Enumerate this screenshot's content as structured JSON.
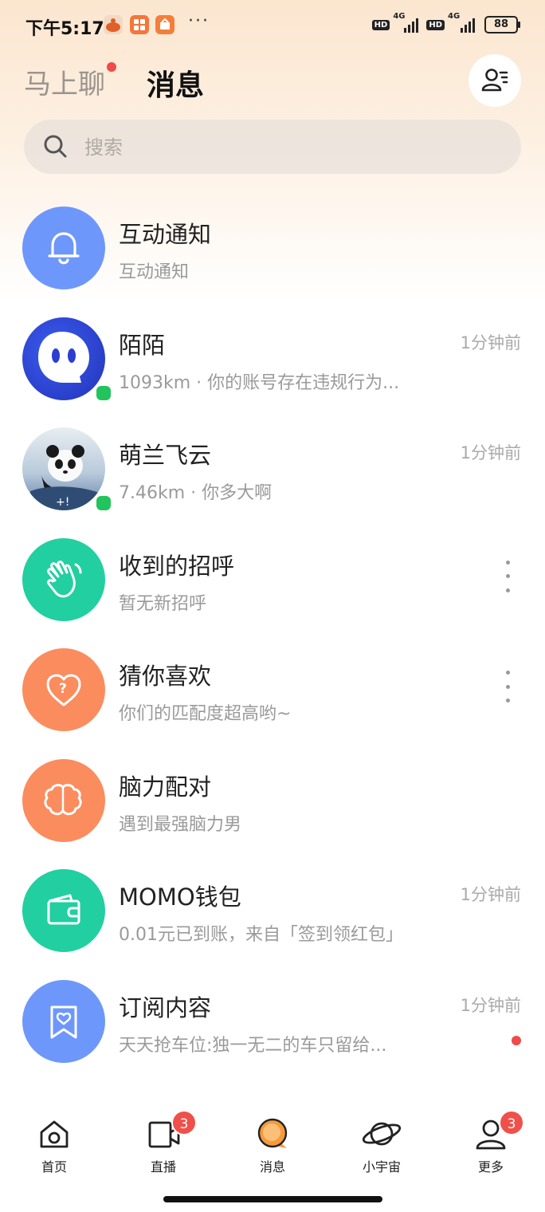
{
  "status_bar": {
    "time": "下午5:17",
    "more": "···",
    "battery": "88",
    "network_1": "4G",
    "network_2": "4G",
    "hd": "HD"
  },
  "header": {
    "tab_chat": "马上聊",
    "tab_messages": "消息"
  },
  "search": {
    "placeholder": "搜索"
  },
  "conversations": [
    {
      "title": "互动通知",
      "subtitle": "互动通知",
      "time": "",
      "icon": "bell-icon",
      "color": "#6e97fb"
    },
    {
      "title": "陌陌",
      "subtitle": "1093km · 你的账号存在违规行为...",
      "time": "1分钟前",
      "icon": "momo-logo",
      "color": "#2f4fe0"
    },
    {
      "title": "萌兰飞云",
      "subtitle": "7.46km · 你多大啊",
      "time": "1分钟前",
      "icon": "panda-avatar",
      "color": "#7fa6c9"
    },
    {
      "title": "收到的招呼",
      "subtitle": "暂无新招呼",
      "time": "",
      "icon": "wave-hand-icon",
      "color": "#22cfa0"
    },
    {
      "title": "猜你喜欢",
      "subtitle": "你们的匹配度超高哟~",
      "time": "",
      "icon": "heart-question-icon",
      "color": "#fb8c5e"
    },
    {
      "title": "脑力配对",
      "subtitle": "遇到最强脑力男",
      "time": "",
      "icon": "brain-icon",
      "color": "#fb8c5e"
    },
    {
      "title": "MOMO钱包",
      "subtitle": "0.01元已到账，来自「签到领红包」",
      "time": "1分钟前",
      "icon": "wallet-icon",
      "color": "#22cfa0"
    },
    {
      "title": "订阅内容",
      "subtitle": "天天抢车位:独一无二的车只留给...",
      "time": "1分钟前",
      "icon": "bookmark-icon",
      "color": "#6e97fb"
    }
  ],
  "bottom_nav": [
    {
      "label": "首页",
      "badge": ""
    },
    {
      "label": "直播",
      "badge": "3"
    },
    {
      "label": "消息",
      "badge": ""
    },
    {
      "label": "小宇宙",
      "badge": ""
    },
    {
      "label": "更多",
      "badge": "3"
    }
  ],
  "colors": {
    "accent_orange": "#f59a3b",
    "badge_red": "#f0504a",
    "online_green": "#21c45d"
  }
}
